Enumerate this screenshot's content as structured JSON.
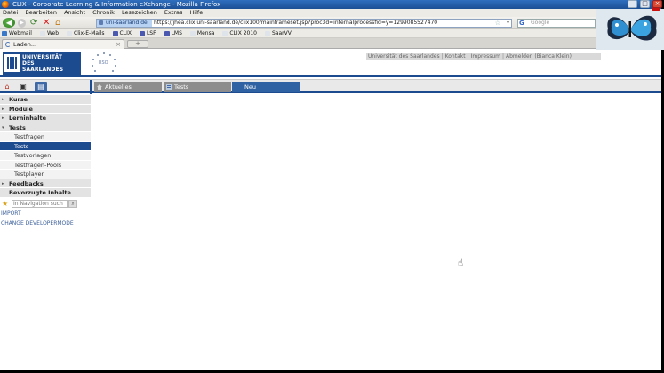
{
  "window": {
    "title": "CLIX - Corporate Learning & Information eXchange - Mozilla Firefox",
    "minimize": "–",
    "maximize": "□",
    "close": "×"
  },
  "menubar": [
    "Datei",
    "Bearbeiten",
    "Ansicht",
    "Chronik",
    "Lesezeichen",
    "Extras",
    "Hilfe"
  ],
  "navbar": {
    "site_identity": "uni-saarland.de",
    "url": "https://jhea.clix.uni-saarland.de/clix100/mainframeset.jsp?proc3d=internalprocessfid=y=1299085527470",
    "search_placeholder": "Google",
    "search_engine_icon": "G",
    "adblock": "ABP"
  },
  "bookmarks": [
    {
      "label": "Webmail",
      "icon": "mail-icon",
      "color": "#3a78c8"
    },
    {
      "label": "Web",
      "icon": "page-icon",
      "color": "#dfe3ea"
    },
    {
      "label": "Clix-E-Mails",
      "icon": "page-icon",
      "color": "#dfe3ea"
    },
    {
      "label": "CLIX",
      "icon": "clix-icon",
      "color": "#4a58b0"
    },
    {
      "label": "LSF",
      "icon": "lsf-icon",
      "color": "#4a58b0"
    },
    {
      "label": "LMS",
      "icon": "lms-icon",
      "color": "#4a58b0"
    },
    {
      "label": "Mensa",
      "icon": "page-icon",
      "color": "#dfe3ea"
    },
    {
      "label": "CLIX 2010",
      "icon": "page-icon",
      "color": "#dfe3ea"
    },
    {
      "label": "SaarVV",
      "icon": "page-icon",
      "color": "#dfe3ea"
    }
  ],
  "tabs": {
    "active_label": "Laden...",
    "new_tab": "+"
  },
  "header": {
    "logo_line1": "UNIVERSITÄT",
    "logo_line2": "DES",
    "logo_line3": "SAARLANDES",
    "seal_text": "RSO",
    "topnav": [
      "Universität des Saarlandes",
      "Kontakt",
      "Impressum",
      "Abmelden (Bianca Klein)"
    ],
    "topnav_sep": "|"
  },
  "content_tabs": [
    {
      "label": "Aktuelles",
      "active": false
    },
    {
      "label": "Tests",
      "active": false
    },
    {
      "label": "Neu",
      "active": true
    }
  ],
  "sidebar": {
    "items": [
      {
        "label": "Kurse",
        "type": "main",
        "arrow": "▸"
      },
      {
        "label": "Module",
        "type": "main",
        "arrow": "▸"
      },
      {
        "label": "Lerninhalte",
        "type": "main",
        "arrow": "▸"
      },
      {
        "label": "Tests",
        "type": "main",
        "arrow": "▾"
      },
      {
        "label": "Testfragen",
        "type": "sub"
      },
      {
        "label": "Tests",
        "type": "sub",
        "active": true
      },
      {
        "label": "Testvorlagen",
        "type": "sub"
      },
      {
        "label": "Testfragen-Pools",
        "type": "sub"
      },
      {
        "label": "Testplayer",
        "type": "sub"
      },
      {
        "label": "Feedbacks",
        "type": "main",
        "arrow": "▸"
      },
      {
        "label": "Bevorzugte Inhalte",
        "type": "main",
        "arrow": ""
      }
    ],
    "search_placeholder": "In Navigation such",
    "search_go": "⌕",
    "links": [
      "IMPORT",
      "CHANGE DEVELOPERMODE"
    ]
  },
  "colors": {
    "brand_blue": "#1d4b8f",
    "active_tab": "#2f62a3",
    "inactive_tab": "#8d8d8d"
  }
}
